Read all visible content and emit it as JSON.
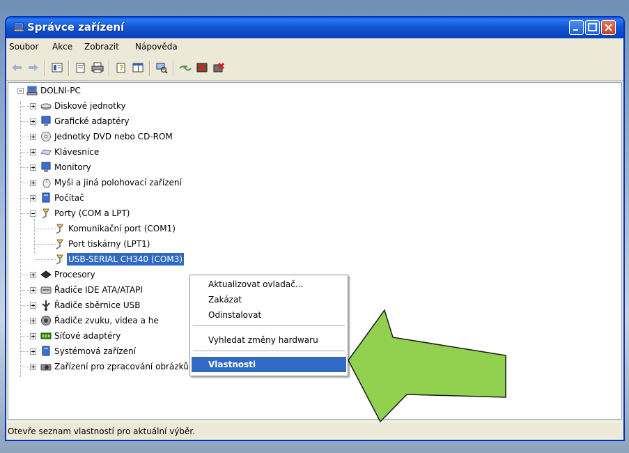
{
  "window": {
    "title": "Správce zařízení"
  },
  "menu": [
    "Soubor",
    "Akce",
    "Zobrazit",
    "Nápověda"
  ],
  "toolbar": {
    "icons": [
      "back-arrow-icon",
      "forward-arrow-icon",
      "view-icon",
      "properties-icon",
      "print-icon",
      "help-icon",
      "console-icon",
      "scan-hardware-icon",
      "update-driver-icon",
      "disable-icon",
      "uninstall-icon"
    ]
  },
  "tree": {
    "root": "DOLNI-PC",
    "items": [
      {
        "label": "Diskové jednotky"
      },
      {
        "label": "Grafické adaptéry"
      },
      {
        "label": "Jednotky DVD nebo CD-ROM"
      },
      {
        "label": "Klávesnice"
      },
      {
        "label": "Monitory"
      },
      {
        "label": "Myši a jiná polohovací zařízení"
      },
      {
        "label": "Počítač"
      },
      {
        "label": "Porty (COM a LPT)"
      },
      {
        "label": "Komunikační port (COM1)"
      },
      {
        "label": "Port tiskárny (LPT1)"
      },
      {
        "label": "USB-SERIAL CH340 (COM3)"
      },
      {
        "label": "Procesory"
      },
      {
        "label": "Řadiče IDE ATA/ATAPI"
      },
      {
        "label": "Řadiče sběrnice USB"
      },
      {
        "label": "Řadiče zvuku, videa a he"
      },
      {
        "label": "Síťové adaptéry"
      },
      {
        "label": "Systémová zařízení"
      },
      {
        "label": "Zařízení pro zpracování obrázků"
      }
    ]
  },
  "context_menu": {
    "items": [
      "Aktualizovat ovladač...",
      "Zakázat",
      "Odinstalovat",
      "Vyhledat změny hardwaru",
      "Vlastnosti"
    ]
  },
  "status": {
    "text": "Otevře seznam vlastností pro aktuální výběr."
  },
  "colors": {
    "selection": "#316ac5",
    "arrow": "#92d050",
    "titlebar": "#0b46c4"
  }
}
